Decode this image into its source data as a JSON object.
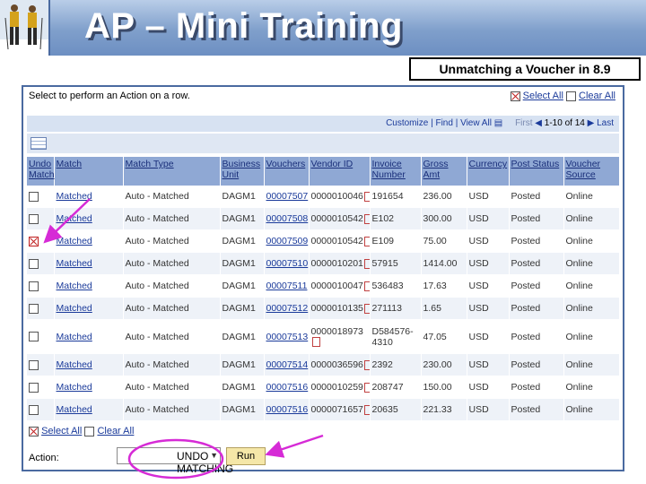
{
  "header": {
    "title": "AP – Mini Training",
    "subtitle": "Unmatching a Voucher in 8.9"
  },
  "panel": {
    "instruction": "Select to perform an Action on a row.",
    "select_all": "Select All",
    "clear_all": "Clear All",
    "nav": {
      "customize": "Customize",
      "find": "Find",
      "view_all": "View All",
      "first": "First",
      "range": "1-10 of 14",
      "last": "Last"
    }
  },
  "grid": {
    "columns": [
      "Undo Match",
      "Match",
      "Match Type",
      "Business Unit",
      "Vouchers",
      "Vendor ID",
      "Invoice Number",
      "Gross Amt",
      "Currency",
      "Post Status",
      "Voucher Source"
    ],
    "rows": [
      {
        "checked": false,
        "match": "Matched",
        "type": "Auto - Matched",
        "bu": "DAGM1",
        "voucher": "00007507",
        "vendor": "0000010046",
        "invoice": "191654",
        "gross": "236.00",
        "currency": "USD",
        "status": "Posted",
        "source": "Online"
      },
      {
        "checked": false,
        "match": "Matched",
        "type": "Auto - Matched",
        "bu": "DAGM1",
        "voucher": "00007508",
        "vendor": "0000010542",
        "invoice": "E102",
        "gross": "300.00",
        "currency": "USD",
        "status": "Posted",
        "source": "Online"
      },
      {
        "checked": true,
        "match": "Matched",
        "type": "Auto - Matched",
        "bu": "DAGM1",
        "voucher": "00007509",
        "vendor": "0000010542",
        "invoice": "E109",
        "gross": "75.00",
        "currency": "USD",
        "status": "Posted",
        "source": "Online"
      },
      {
        "checked": false,
        "match": "Matched",
        "type": "Auto - Matched",
        "bu": "DAGM1",
        "voucher": "00007510",
        "vendor": "0000010201",
        "invoice": "57915",
        "gross": "1414.00",
        "currency": "USD",
        "status": "Posted",
        "source": "Online"
      },
      {
        "checked": false,
        "match": "Matched",
        "type": "Auto - Matched",
        "bu": "DAGM1",
        "voucher": "00007511",
        "vendor": "0000010047",
        "invoice": "536483",
        "gross": "17.63",
        "currency": "USD",
        "status": "Posted",
        "source": "Online"
      },
      {
        "checked": false,
        "match": "Matched",
        "type": "Auto - Matched",
        "bu": "DAGM1",
        "voucher": "00007512",
        "vendor": "0000010135",
        "invoice": "271113",
        "gross": "1.65",
        "currency": "USD",
        "status": "Posted",
        "source": "Online"
      },
      {
        "checked": false,
        "match": "Matched",
        "type": "Auto - Matched",
        "bu": "DAGM1",
        "voucher": "00007513",
        "vendor": "0000018973",
        "invoice": "D584576-4310",
        "gross": "47.05",
        "currency": "USD",
        "status": "Posted",
        "source": "Online"
      },
      {
        "checked": false,
        "match": "Matched",
        "type": "Auto - Matched",
        "bu": "DAGM1",
        "voucher": "00007514",
        "vendor": "0000036596",
        "invoice": "2392",
        "gross": "230.00",
        "currency": "USD",
        "status": "Posted",
        "source": "Online"
      },
      {
        "checked": false,
        "match": "Matched",
        "type": "Auto - Matched",
        "bu": "DAGM1",
        "voucher": "00007516",
        "vendor": "0000010259",
        "invoice": "208747",
        "gross": "150.00",
        "currency": "USD",
        "status": "Posted",
        "source": "Online"
      },
      {
        "checked": false,
        "match": "Matched",
        "type": "Auto - Matched",
        "bu": "DAGM1",
        "voucher": "00007516",
        "vendor": "0000071657",
        "invoice": "20635",
        "gross": "221.33",
        "currency": "USD",
        "status": "Posted",
        "source": "Online"
      }
    ]
  },
  "footer": {
    "select_all": "Select All",
    "clear_all": "Clear All",
    "action_label": "Action:",
    "action_value": "UNDO MATCHING",
    "run_label": "Run"
  },
  "colors": {
    "annotation": "#d62bd6",
    "header_blue": "#8fa8d4",
    "link_blue": "#1a3a9a"
  }
}
